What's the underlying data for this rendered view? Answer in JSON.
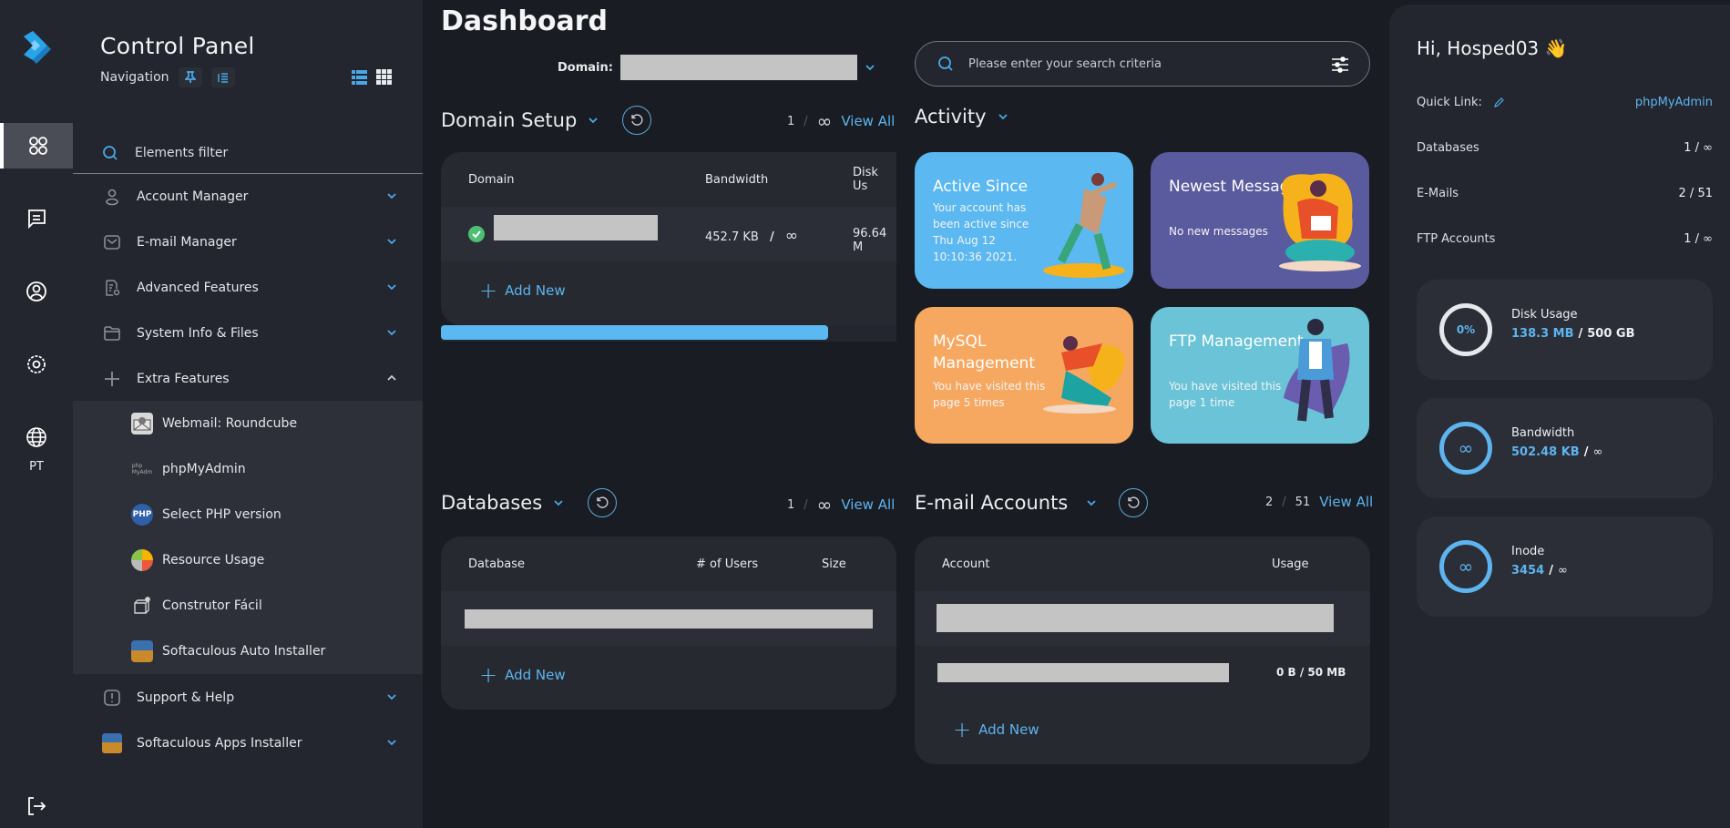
{
  "rail": {
    "items": [
      {
        "name": "dashboard",
        "active": true
      },
      {
        "name": "messages"
      },
      {
        "name": "account"
      },
      {
        "name": "settings"
      },
      {
        "name": "language"
      }
    ],
    "language_code": "PT"
  },
  "nav": {
    "title": "Control Panel",
    "subtitle": "Navigation",
    "filter_placeholder": "Elements filter",
    "sections": [
      {
        "label": "Account Manager",
        "icon": "user-icon",
        "expanded": false
      },
      {
        "label": "E-mail Manager",
        "icon": "mail-icon",
        "expanded": false
      },
      {
        "label": "Advanced Features",
        "icon": "file-settings-icon",
        "expanded": false
      },
      {
        "label": "System Info & Files",
        "icon": "folder-icon",
        "expanded": false
      },
      {
        "label": "Extra Features",
        "icon": "plus-icon",
        "expanded": true
      },
      {
        "label": "Support & Help",
        "icon": "alert-icon",
        "expanded": false
      },
      {
        "label": "Softaculous Apps Installer",
        "icon": "softaculous-icon",
        "expanded": false
      }
    ],
    "extra_features": [
      {
        "label": "Webmail: Roundcube",
        "icon": "roundcube-icon"
      },
      {
        "label": "phpMyAdmin",
        "icon": "phpmyadmin-icon"
      },
      {
        "label": "Select PHP version",
        "icon": "php-icon"
      },
      {
        "label": "Resource Usage",
        "icon": "gauge-icon"
      },
      {
        "label": "Construtor Fácil",
        "icon": "builder-icon"
      },
      {
        "label": "Softaculous Auto Installer",
        "icon": "softaculous-icon"
      }
    ]
  },
  "main": {
    "title": "Dashboard",
    "domain_label": "Domain:",
    "search_placeholder": "Please enter your search criteria",
    "domain_setup": {
      "title": "Domain Setup",
      "count": "1",
      "limit": "∞",
      "view_all": "View All",
      "columns": [
        "Domain",
        "Bandwidth",
        "Disk Us"
      ],
      "rows": [
        {
          "status": "active",
          "bandwidth_used": "452.7 KB",
          "bandwidth_limit": "∞",
          "disk": "96.64 M"
        }
      ],
      "add_new": "Add New",
      "scroll_fraction": 0.85
    },
    "activity": {
      "title": "Activity",
      "cards": [
        {
          "title": "Active Since",
          "desc": "Your account has been active since Thu Aug 12 10:10:36 2021.",
          "color": "#5bb8f0"
        },
        {
          "title": "Newest Message",
          "desc": "No new messages",
          "color": "#5a5a9e"
        },
        {
          "title": "MySQL Management",
          "desc": "You have visited this page 5 times",
          "color": "#f7a860"
        },
        {
          "title": "FTP Management",
          "desc": "You have visited this page 1 time",
          "color": "#6ac3d6"
        }
      ]
    },
    "databases": {
      "title": "Databases",
      "count": "1",
      "limit": "∞",
      "view_all": "View All",
      "columns": [
        "Database",
        "# of Users",
        "Size"
      ],
      "add_new": "Add New"
    },
    "email_accounts": {
      "title": "E-mail Accounts",
      "count": "2",
      "limit": "51",
      "view_all": "View All",
      "columns": [
        "Account",
        "Usage"
      ],
      "rows": [
        {
          "usage": ""
        },
        {
          "usage": "0 B / 50 MB"
        }
      ],
      "add_new": "Add New"
    }
  },
  "right_panel": {
    "greeting": "Hi, Hosped03",
    "greeting_emoji": "👋",
    "quick_link_label": "Quick Link:",
    "quick_link_value": "phpMyAdmin",
    "stats": [
      {
        "label": "Databases",
        "value": "1 / ∞"
      },
      {
        "label": "E-Mails",
        "value": "2 / 51"
      },
      {
        "label": "FTP Accounts",
        "value": "1 / ∞"
      }
    ],
    "usage": [
      {
        "title": "Disk Usage",
        "ring": "0%",
        "used": "138.3 MB",
        "max": "500 GB",
        "percent": 0
      },
      {
        "title": "Bandwidth",
        "ring": "∞",
        "used": "502.48 KB",
        "max": "∞"
      },
      {
        "title": "Inode",
        "ring": "∞",
        "used": "3454",
        "max": "∞"
      }
    ]
  },
  "colors": {
    "accent": "#5db4ee",
    "background": "#191c22",
    "panel": "#23262e",
    "card": "#262930",
    "success": "#4cbf72"
  }
}
